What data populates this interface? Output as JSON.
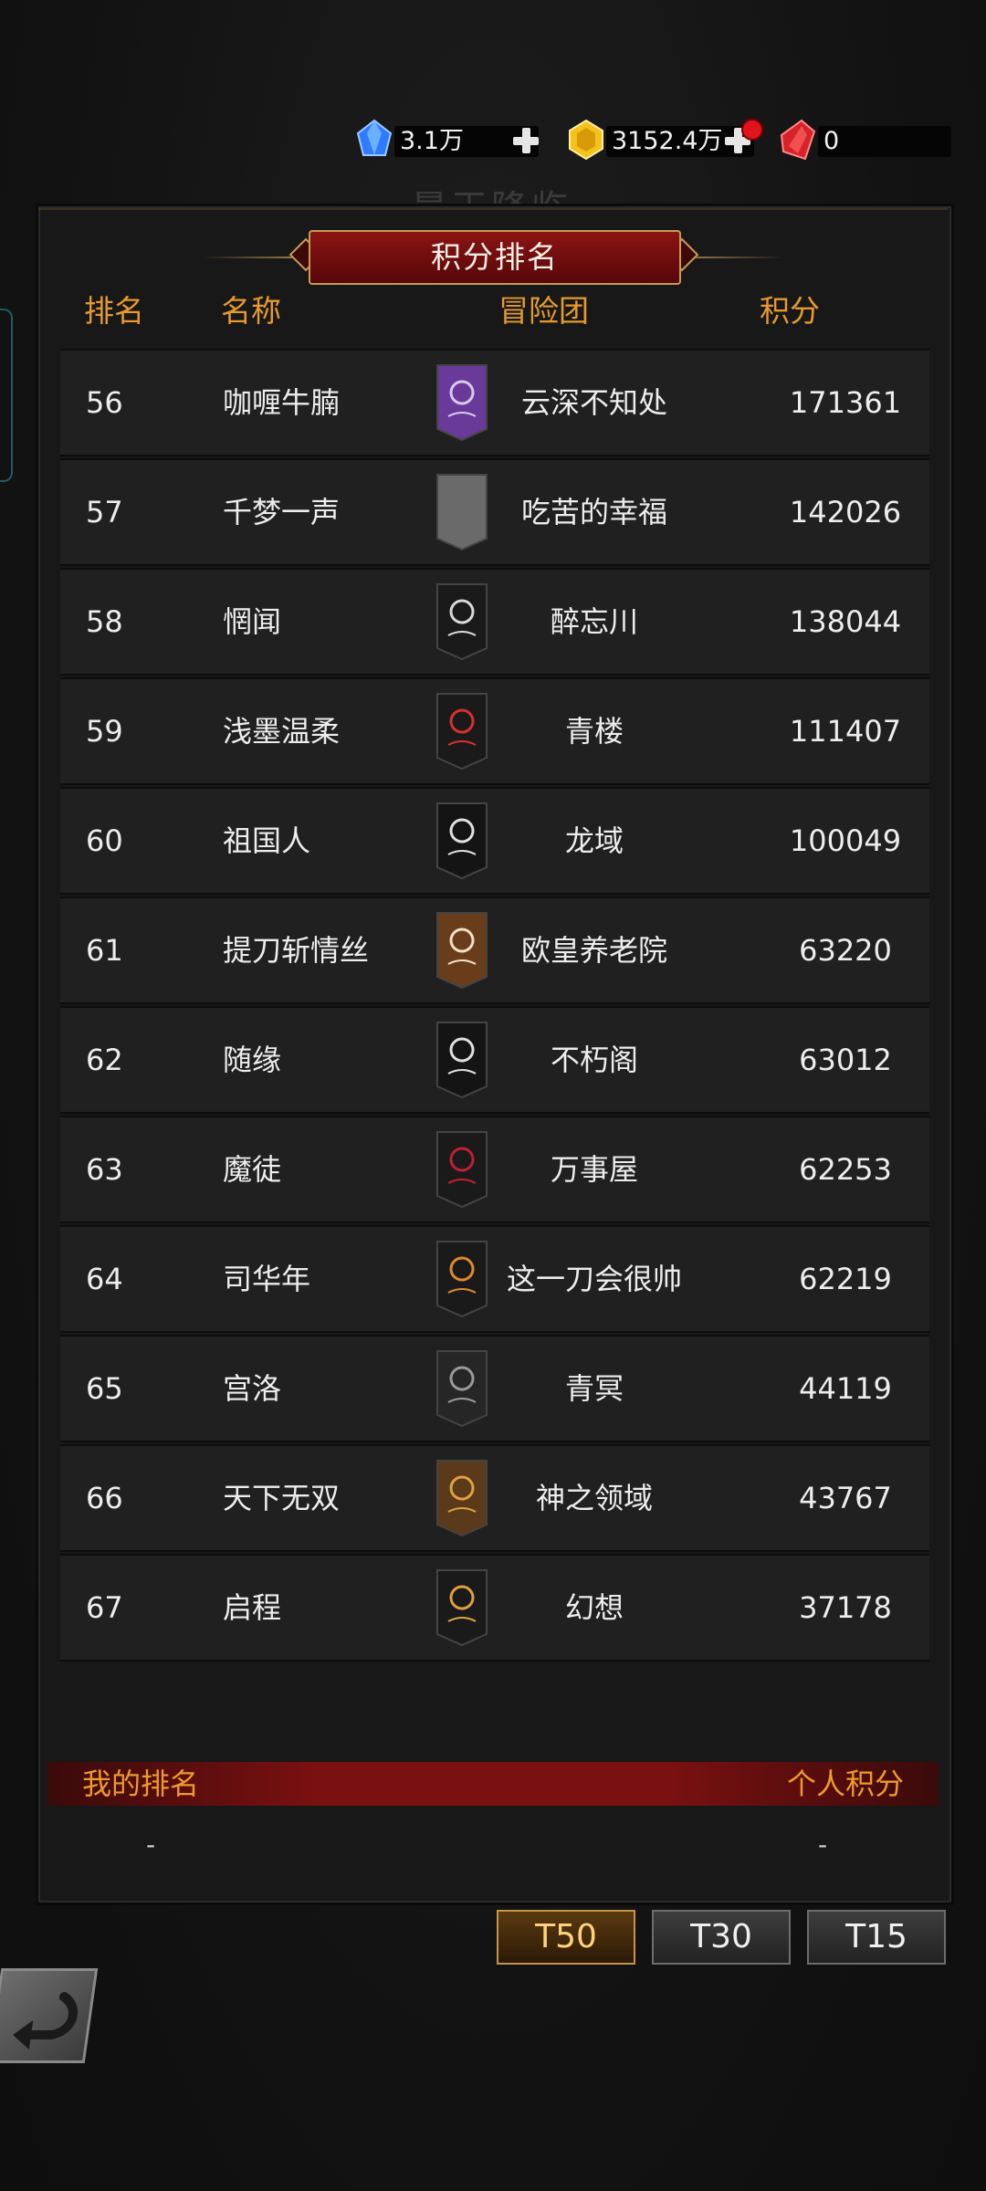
{
  "currencies": [
    {
      "icon": "blue-diamond-icon",
      "value": "3.1万",
      "color": "#2f7bff"
    },
    {
      "icon": "gold-crystal-icon",
      "value": "3152.4万",
      "color": "#f4c21a"
    },
    {
      "icon": "red-gem-icon",
      "value": "0",
      "color": "#d8222a"
    }
  ],
  "background_title": "晨王降临",
  "panel": {
    "title": "积分排名",
    "headers": {
      "rank": "排名",
      "name": "名称",
      "guild": "冒险团",
      "score": "积分"
    },
    "rows": [
      {
        "rank": "56",
        "name": "咖喱牛腩",
        "guild": "云深不知处",
        "score": "171361",
        "flag": "purple-wing-banner-icon"
      },
      {
        "rank": "57",
        "name": "千梦一声",
        "guild": "吃苦的幸福",
        "score": "142026",
        "flag": "gray-blank-banner-icon"
      },
      {
        "rank": "58",
        "name": "惘闻",
        "guild": "醉忘川",
        "score": "138044",
        "flag": "black-moon-banner-icon"
      },
      {
        "rank": "59",
        "name": "浅墨温柔",
        "guild": "青楼",
        "score": "111407",
        "flag": "red-hexagram-banner-icon"
      },
      {
        "rank": "60",
        "name": "祖国人",
        "guild": "龙域",
        "score": "100049",
        "flag": "black-skull-banner-icon"
      },
      {
        "rank": "61",
        "name": "提刀斩情丝",
        "guild": "欧皇养老院",
        "score": "63220",
        "flag": "brown-skull-banner-icon"
      },
      {
        "rank": "62",
        "name": "随缘",
        "guild": "不朽阁",
        "score": "63012",
        "flag": "black-skull-banner-icon"
      },
      {
        "rank": "63",
        "name": "魔徒",
        "guild": "万事屋",
        "score": "62253",
        "flag": "red-serpent-banner-icon"
      },
      {
        "rank": "64",
        "name": "司华年",
        "guild": "这一刀会很帅",
        "score": "62219",
        "flag": "orange-axes-banner-icon"
      },
      {
        "rank": "65",
        "name": "宫洛",
        "guild": "青冥",
        "score": "44119",
        "flag": "gray-skull-banner-icon"
      },
      {
        "rank": "66",
        "name": "天下无双",
        "guild": "神之领域",
        "score": "43767",
        "flag": "bronze-skull-banner-icon"
      },
      {
        "rank": "67",
        "name": "启程",
        "guild": "幻想",
        "score": "37178",
        "flag": "gold-hexagram-banner-icon"
      }
    ]
  },
  "my_rank": {
    "label": "我的排名",
    "score_label": "个人积分",
    "rank_value": "-",
    "score_value": "-"
  },
  "tier_tabs": [
    {
      "label": "T50",
      "active": true
    },
    {
      "label": "T30",
      "active": false
    },
    {
      "label": "T15",
      "active": false
    }
  ],
  "back_button": {
    "icon": "return-arrow-icon"
  }
}
